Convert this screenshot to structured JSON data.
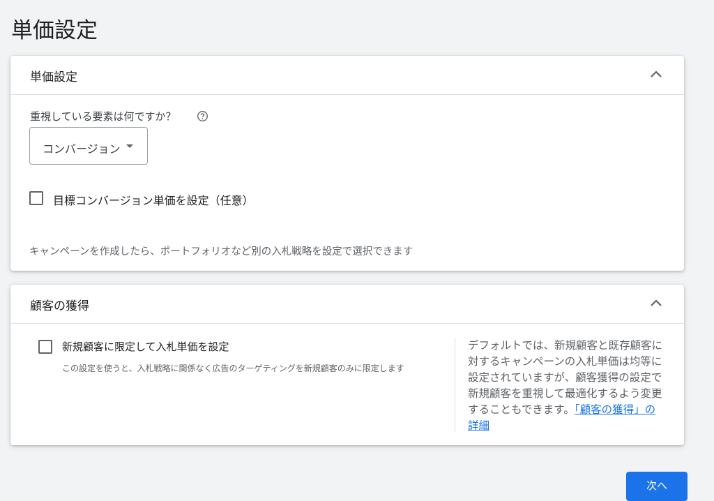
{
  "page": {
    "title": "単価設定"
  },
  "bidding_card": {
    "title": "単価設定",
    "question": "重視している要素は何ですか？",
    "focus_dropdown": {
      "selected": "コンバージョン"
    },
    "target_cpa_checkbox": {
      "label": "目標コンバージョン単価を設定（任意）",
      "checked": false
    },
    "note": "キャンペーンを作成したら、ポートフォリオなど別の入札戦略を設定で選択できます"
  },
  "acquisition_card": {
    "title": "顧客の獲得",
    "new_customers_checkbox": {
      "label": "新規顧客に限定して入札単価を設定",
      "description": "この設定を使うと、入札戦略に関係なく広告のターゲティングを新規顧客のみに限定します",
      "checked": false
    },
    "side_info": {
      "text": "デフォルトでは、新規顧客と既存顧客に対するキャンペーンの入札単価は均等に設定されていますが、顧客獲得の設定で新規顧客を重視して最適化するよう変更することもできます。",
      "link": "「顧客の獲得」の詳細"
    }
  },
  "footer": {
    "next_label": "次へ"
  },
  "colors": {
    "background": "#f1f3f4",
    "accent": "#1a73e8",
    "card": "#ffffff"
  },
  "icons": [
    "chevron-up-icon",
    "help-circle-icon",
    "dropdown-arrow-icon"
  ]
}
